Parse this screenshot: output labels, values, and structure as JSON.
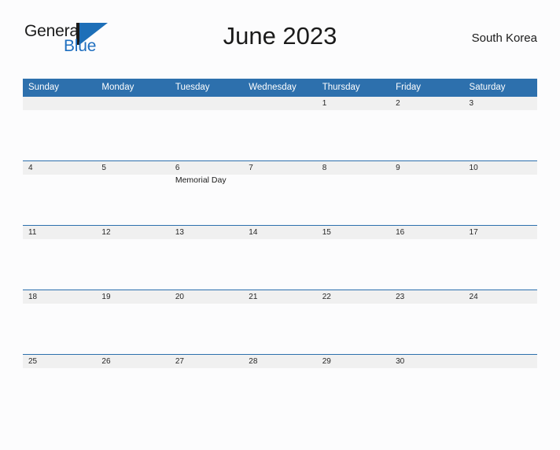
{
  "brand": {
    "name_part1": "General",
    "name_part2": "Blue",
    "mark": "sail-triangle-icon"
  },
  "header": {
    "title": "June 2023",
    "region": "South Korea"
  },
  "calendar": {
    "weekday_headers": [
      "Sunday",
      "Monday",
      "Tuesday",
      "Wednesday",
      "Thursday",
      "Friday",
      "Saturday"
    ],
    "accent_color": "#2d70ad",
    "daynum_band_color": "#f0f0f0",
    "weeks": [
      [
        {
          "day": "",
          "events": []
        },
        {
          "day": "",
          "events": []
        },
        {
          "day": "",
          "events": []
        },
        {
          "day": "",
          "events": []
        },
        {
          "day": "1",
          "events": []
        },
        {
          "day": "2",
          "events": []
        },
        {
          "day": "3",
          "events": []
        }
      ],
      [
        {
          "day": "4",
          "events": []
        },
        {
          "day": "5",
          "events": []
        },
        {
          "day": "6",
          "events": [
            "Memorial Day"
          ]
        },
        {
          "day": "7",
          "events": []
        },
        {
          "day": "8",
          "events": []
        },
        {
          "day": "9",
          "events": []
        },
        {
          "day": "10",
          "events": []
        }
      ],
      [
        {
          "day": "11",
          "events": []
        },
        {
          "day": "12",
          "events": []
        },
        {
          "day": "13",
          "events": []
        },
        {
          "day": "14",
          "events": []
        },
        {
          "day": "15",
          "events": []
        },
        {
          "day": "16",
          "events": []
        },
        {
          "day": "17",
          "events": []
        }
      ],
      [
        {
          "day": "18",
          "events": []
        },
        {
          "day": "19",
          "events": []
        },
        {
          "day": "20",
          "events": []
        },
        {
          "day": "21",
          "events": []
        },
        {
          "day": "22",
          "events": []
        },
        {
          "day": "23",
          "events": []
        },
        {
          "day": "24",
          "events": []
        }
      ],
      [
        {
          "day": "25",
          "events": []
        },
        {
          "day": "26",
          "events": []
        },
        {
          "day": "27",
          "events": []
        },
        {
          "day": "28",
          "events": []
        },
        {
          "day": "29",
          "events": []
        },
        {
          "day": "30",
          "events": []
        },
        {
          "day": "",
          "events": []
        }
      ]
    ]
  }
}
